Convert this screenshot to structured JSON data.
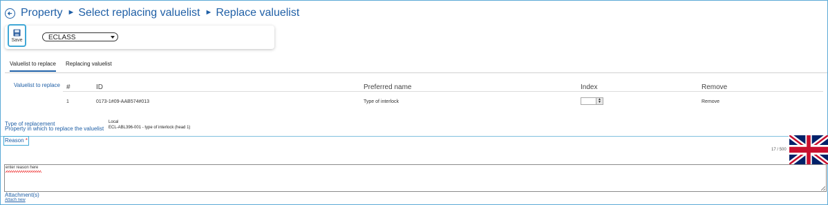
{
  "breadcrumb": {
    "items": [
      "Property",
      "Select replacing valuelist",
      "Replace valuelist"
    ],
    "separator": "►"
  },
  "toolbar": {
    "save_label": "Save",
    "dictionary_select": "ECLASS"
  },
  "tabs": [
    {
      "label": "Valuelist to replace",
      "active": true
    },
    {
      "label": "Replacing valuelist",
      "active": false
    }
  ],
  "valuelist_section": {
    "label": "Valuelist to replace",
    "columns": [
      "#",
      "ID",
      "Preferred name",
      "Index",
      "Remove"
    ],
    "rows": [
      {
        "num": "1",
        "id": "0173-1#09-AAB574#013",
        "preferred_name": "Type of interlock",
        "index": "",
        "remove": "Remove"
      }
    ]
  },
  "details": {
    "type_label": "Type of replacement",
    "type_value": "Local",
    "property_label": "Property in which to replace the valuelist",
    "property_value": "ECL-ABL396-001 - type of interlock (head 1)"
  },
  "reason": {
    "label": "Reason",
    "required_mark": "*",
    "counter": "17 / 500",
    "text": "enter reason here"
  },
  "attachments": {
    "label": "Attachment(s)",
    "link": "Attach new"
  },
  "colors": {
    "accent": "#1f5fa6",
    "focus_border": "#3fa7d6",
    "required": "#d9272e"
  },
  "icons": {
    "back": "back-arrow-circle-icon",
    "save": "floppy-disk-icon",
    "language": "uk-flag-icon"
  }
}
